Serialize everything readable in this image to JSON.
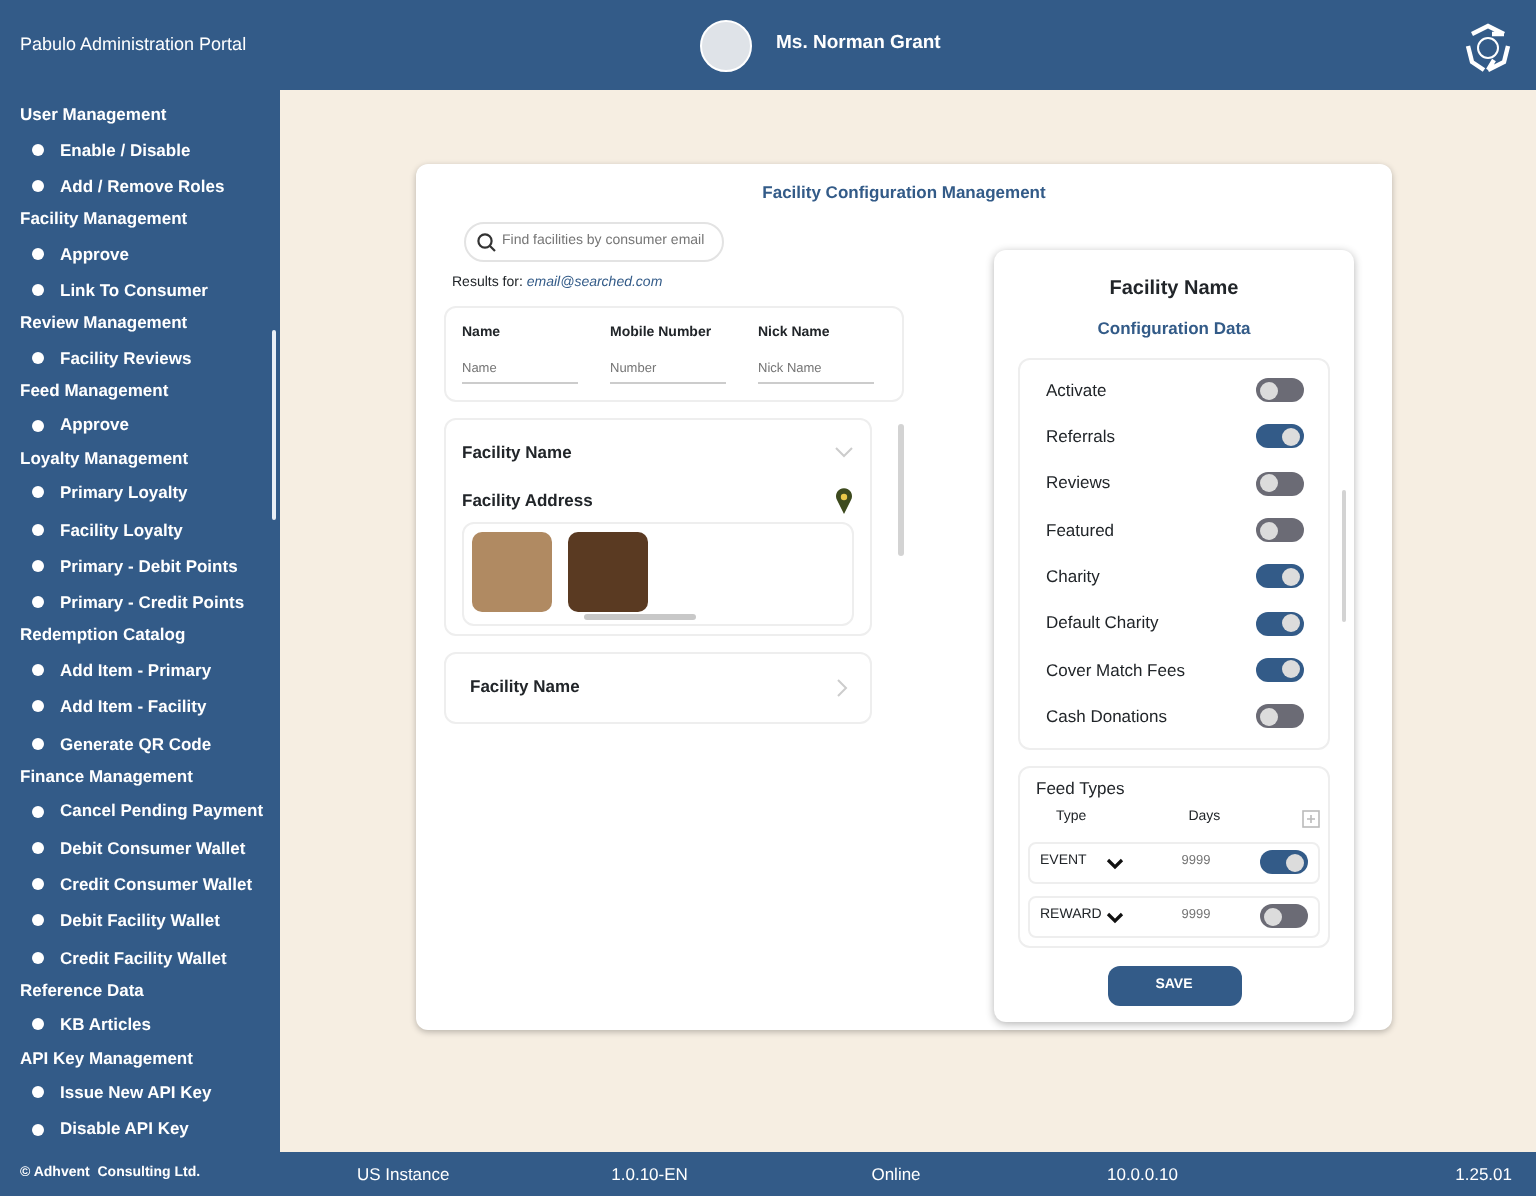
{
  "header": {
    "title": "Pabulo Administration Portal",
    "user_name": "Ms. Norman Grant"
  },
  "sidebar": {
    "groups": [
      {
        "label": "User Management",
        "items": [
          "Enable / Disable",
          "Add / Remove Roles"
        ]
      },
      {
        "label": "Facility Management",
        "items": [
          "Approve",
          "Link To Consumer"
        ]
      },
      {
        "label": "Review Management",
        "items": [
          "Facility Reviews"
        ]
      },
      {
        "label": "Feed Management",
        "items": [
          "Approve"
        ]
      },
      {
        "label": "Loyalty Management",
        "items": [
          "Primary Loyalty",
          "Facility Loyalty",
          "Primary - Debit Points",
          "Primary - Credit Points"
        ]
      },
      {
        "label": "Redemption Catalog",
        "items": [
          "Add Item - Primary",
          "Add Item - Facility",
          "Generate QR Code"
        ]
      },
      {
        "label": "Finance Management",
        "items": [
          "Cancel Pending Payment",
          "Debit Consumer Wallet",
          "Credit Consumer Wallet",
          "Debit Facility Wallet",
          "Credit Facility Wallet"
        ]
      },
      {
        "label": "Reference Data",
        "items": [
          "KB Articles"
        ]
      },
      {
        "label": "API Key Management",
        "items": [
          "Issue New API Key",
          "Disable API Key"
        ]
      }
    ]
  },
  "main": {
    "title": "Facility Configuration Management",
    "search": {
      "placeholder": "Find facilities by consumer email"
    },
    "results_label": "Results for:",
    "results_email": "email@searched.com",
    "filters": [
      {
        "label": "Name",
        "placeholder": "Name"
      },
      {
        "label": "Mobile Number",
        "placeholder": "Number"
      },
      {
        "label": "Nick Name",
        "placeholder": "Nick Name"
      }
    ],
    "facilities": [
      {
        "name": "Facility Name",
        "expanded": true,
        "address": "Facility Address"
      },
      {
        "name": "Facility Name",
        "expanded": false
      }
    ]
  },
  "config": {
    "name": "Facility Name",
    "subtitle": "Configuration Data",
    "toggles": [
      {
        "label": "Activate",
        "on": false
      },
      {
        "label": "Referrals",
        "on": true
      },
      {
        "label": "Reviews",
        "on": false
      },
      {
        "label": "Featured",
        "on": false
      },
      {
        "label": "Charity",
        "on": true
      },
      {
        "label": "Default Charity",
        "on": true
      },
      {
        "label": "Cover Match Fees",
        "on": true
      },
      {
        "label": "Cash Donations",
        "on": false
      }
    ],
    "feed_types": {
      "title": "Feed Types",
      "columns": [
        "Type",
        "Days"
      ],
      "rows": [
        {
          "type": "EVENT",
          "placeholder": "9999",
          "on": true
        },
        {
          "type": "REWARD",
          "placeholder": "9999",
          "on": false
        }
      ]
    },
    "save": "SAVE"
  },
  "footer": {
    "copyright": "© Adhvent  Consulting Ltd.",
    "items": [
      "US Instance",
      "1.0.10-EN",
      "Online",
      "10.0.0.10",
      "1.25.01"
    ]
  }
}
